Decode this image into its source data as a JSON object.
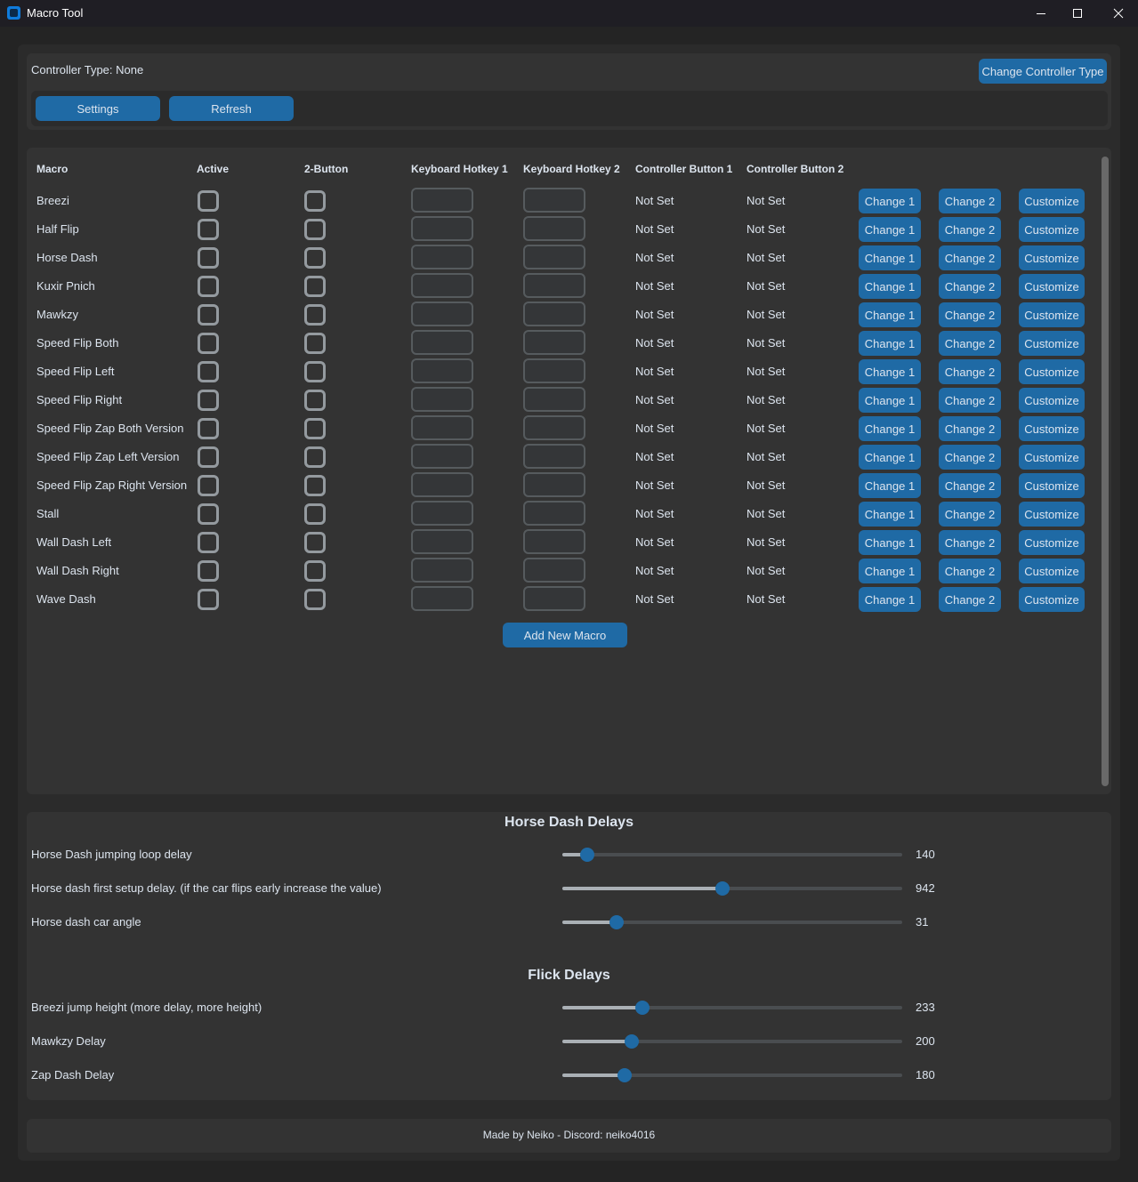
{
  "window": {
    "title": "Macro Tool",
    "icon": "app-icon",
    "controls": [
      "minimize-icon",
      "maximize-icon",
      "close-icon"
    ]
  },
  "top": {
    "controller_type_label": "Controller Type: None",
    "change_controller_button": "Change Controller Type",
    "settings_button": "Settings",
    "refresh_button": "Refresh"
  },
  "table": {
    "headers": {
      "macro": "Macro",
      "active": "Active",
      "two_button": "2-Button",
      "keyboard_hotkey_1": "Keyboard Hotkey 1",
      "keyboard_hotkey_2": "Keyboard Hotkey 2",
      "controller_button_1": "Controller Button 1",
      "controller_button_2": "Controller Button 2"
    },
    "row_buttons": {
      "change1": "Change 1",
      "change2": "Change 2",
      "customize": "Customize"
    },
    "rows": [
      {
        "name": "Breezi",
        "active": false,
        "two_button": false,
        "hotkey1": "",
        "hotkey2": "",
        "controller1": "Not Set",
        "controller2": "Not Set"
      },
      {
        "name": "Half Flip",
        "active": false,
        "two_button": false,
        "hotkey1": "",
        "hotkey2": "",
        "controller1": "Not Set",
        "controller2": "Not Set"
      },
      {
        "name": "Horse Dash",
        "active": false,
        "two_button": false,
        "hotkey1": "",
        "hotkey2": "",
        "controller1": "Not Set",
        "controller2": "Not Set"
      },
      {
        "name": "Kuxir Pnich",
        "active": false,
        "two_button": false,
        "hotkey1": "",
        "hotkey2": "",
        "controller1": "Not Set",
        "controller2": "Not Set"
      },
      {
        "name": "Mawkzy",
        "active": false,
        "two_button": false,
        "hotkey1": "",
        "hotkey2": "",
        "controller1": "Not Set",
        "controller2": "Not Set"
      },
      {
        "name": "Speed Flip Both",
        "active": false,
        "two_button": false,
        "hotkey1": "",
        "hotkey2": "",
        "controller1": "Not Set",
        "controller2": "Not Set"
      },
      {
        "name": "Speed Flip Left",
        "active": false,
        "two_button": false,
        "hotkey1": "",
        "hotkey2": "",
        "controller1": "Not Set",
        "controller2": "Not Set"
      },
      {
        "name": "Speed Flip Right",
        "active": false,
        "two_button": false,
        "hotkey1": "",
        "hotkey2": "",
        "controller1": "Not Set",
        "controller2": "Not Set"
      },
      {
        "name": "Speed Flip Zap Both Version",
        "active": false,
        "two_button": false,
        "hotkey1": "",
        "hotkey2": "",
        "controller1": "Not Set",
        "controller2": "Not Set"
      },
      {
        "name": "Speed Flip Zap Left Version",
        "active": false,
        "two_button": false,
        "hotkey1": "",
        "hotkey2": "",
        "controller1": "Not Set",
        "controller2": "Not Set"
      },
      {
        "name": "Speed Flip Zap Right Version",
        "active": false,
        "two_button": false,
        "hotkey1": "",
        "hotkey2": "",
        "controller1": "Not Set",
        "controller2": "Not Set"
      },
      {
        "name": "Stall",
        "active": false,
        "two_button": false,
        "hotkey1": "",
        "hotkey2": "",
        "controller1": "Not Set",
        "controller2": "Not Set"
      },
      {
        "name": "Wall Dash Left",
        "active": false,
        "two_button": false,
        "hotkey1": "",
        "hotkey2": "",
        "controller1": "Not Set",
        "controller2": "Not Set"
      },
      {
        "name": "Wall Dash Right",
        "active": false,
        "two_button": false,
        "hotkey1": "",
        "hotkey2": "",
        "controller1": "Not Set",
        "controller2": "Not Set"
      },
      {
        "name": "Wave Dash",
        "active": false,
        "two_button": false,
        "hotkey1": "",
        "hotkey2": "",
        "controller1": "Not Set",
        "controller2": "Not Set"
      }
    ],
    "add_button": "Add New Macro"
  },
  "delays": {
    "sections": [
      {
        "title": "Horse Dash Delays",
        "sliders": [
          {
            "label": "Horse Dash jumping loop delay",
            "value": "140",
            "fraction": 0.073
          },
          {
            "label": "Horse dash first setup delay. (if the car flips early increase the value)",
            "value": "942",
            "fraction": 0.471
          },
          {
            "label": "Horse dash car angle",
            "value": "31",
            "fraction": 0.16
          }
        ]
      },
      {
        "title": "Flick Delays",
        "sliders": [
          {
            "label": "Breezi jump height (more delay, more height)",
            "value": "233",
            "fraction": 0.236
          },
          {
            "label": "Mawkzy Delay",
            "value": "200",
            "fraction": 0.204
          },
          {
            "label": "Zap Dash Delay",
            "value": "180",
            "fraction": 0.183
          }
        ]
      }
    ]
  },
  "footer": {
    "text": "Made by Neiko - Discord: neiko4016"
  },
  "colors": {
    "accent": "#1f6aa5",
    "background": "#242424",
    "frame": "#2b2b2b",
    "panel": "#333333",
    "text": "#dce4ee"
  }
}
